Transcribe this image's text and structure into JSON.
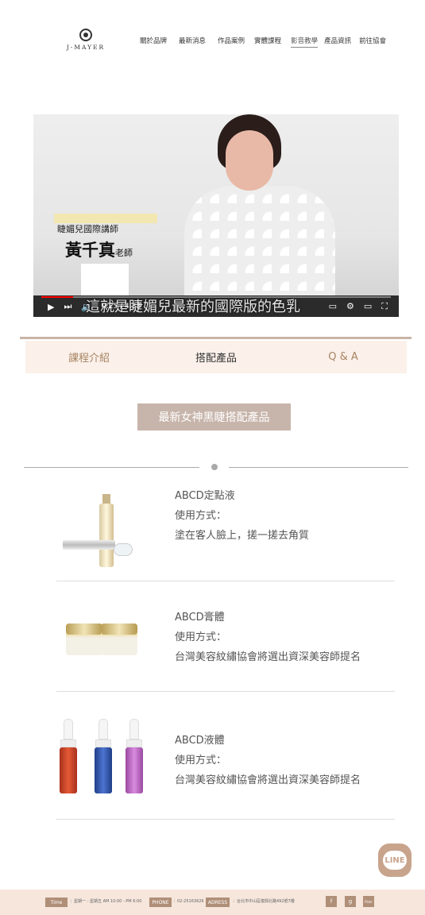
{
  "header": {
    "logo_text": "J-MAYER",
    "nav": [
      {
        "label": "關於品牌"
      },
      {
        "label": "最新消息"
      },
      {
        "label": "作品案例"
      },
      {
        "label": "實體課程"
      },
      {
        "label": "影音教學"
      },
      {
        "label": "產品資訊"
      },
      {
        "label": "前往協會"
      }
    ],
    "active_nav": "影音教學"
  },
  "video": {
    "overlay_title": "睫媚兒國際講師",
    "overlay_name": "黃千真",
    "overlay_suffix": "老師",
    "subtitle": "這就是睫媚兒最新的國際版的色乳",
    "time": "0:25 / 4:33",
    "progress": 0.09
  },
  "tabs": [
    {
      "label": "課程介紹"
    },
    {
      "label": "搭配產品"
    },
    {
      "label": "Q & A"
    }
  ],
  "active_tab": "搭配產品",
  "section_title": "最新女神黑睫搭配產品",
  "products": [
    {
      "name": "ABCD定點液",
      "usage_label": "使用方式：",
      "usage": "塗在客人臉上，搓一搓去角質"
    },
    {
      "name": "ABCD膏體",
      "usage_label": "使用方式：",
      "usage": "台灣美容紋繡協會將選出資深美容師提名"
    },
    {
      "name": "ABCD液體",
      "usage_label": "使用方式：",
      "usage": "台灣美容紋繡協會將選出資深美容師提名"
    }
  ],
  "line_button": "LINE",
  "footer": {
    "time_tag": "Time",
    "time_text": "：星期一 - 星期五 AM 10:00 - PM 6:00",
    "phone_tag": "PHONE",
    "phone_text": "：02-25163626",
    "address_tag": "ADRESS",
    "address_text": "：台北市中山區復興北路492號7樓",
    "social": [
      "f",
      "g",
      "flickr"
    ]
  },
  "colors": {
    "accent": "#c7b5ab",
    "tab_bg": "#fbf0ea",
    "tab_text": "#a78462",
    "footer_bg": "#f6e6dc",
    "line_bg": "#c8a48d"
  }
}
